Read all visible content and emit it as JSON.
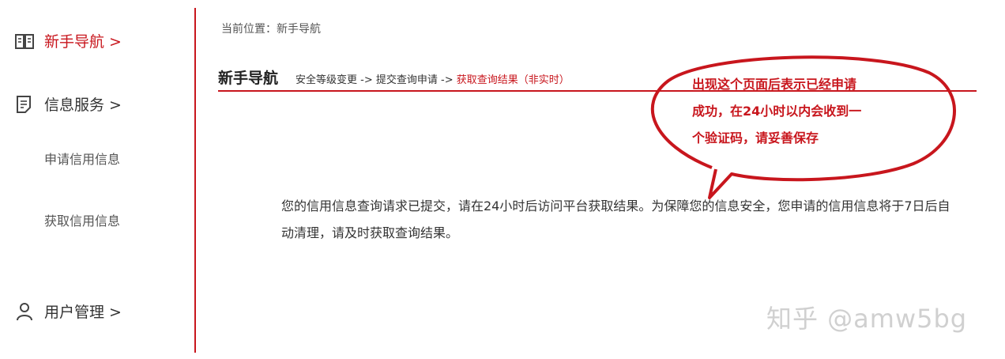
{
  "sidebar": {
    "items": [
      {
        "label": "新手导航 >",
        "icon": "book-icon",
        "active": true
      },
      {
        "label": "信息服务 >",
        "icon": "document-icon",
        "active": false
      },
      {
        "label": "用户管理 >",
        "icon": "user-icon",
        "active": false
      }
    ],
    "subitems": [
      {
        "label": "申请信用信息"
      },
      {
        "label": "获取信用信息"
      }
    ]
  },
  "main": {
    "breadcrumb": "当前位置：新手导航",
    "title": "新手导航",
    "steps": {
      "step1": "安全等级变更",
      "arrow": " -> ",
      "step2": "提交查询申请",
      "step3": "获取查询结果（非实时）"
    },
    "message": "您的信用信息查询请求已提交，请在24小时后访问平台获取结果。为保障您的信息安全，您申请的信用信息将于7日后自动清理，请及时获取查询结果。"
  },
  "annotation": {
    "lines": [
      "出现这个页面后表示已经申请",
      "成功，在24小时以内会收到一",
      "个验证码，请妥善保存"
    ]
  },
  "watermark": "知乎 @amw5bg",
  "colors": {
    "accent": "#c8161d",
    "text": "#333333",
    "watermark": "#d0d0d0"
  }
}
